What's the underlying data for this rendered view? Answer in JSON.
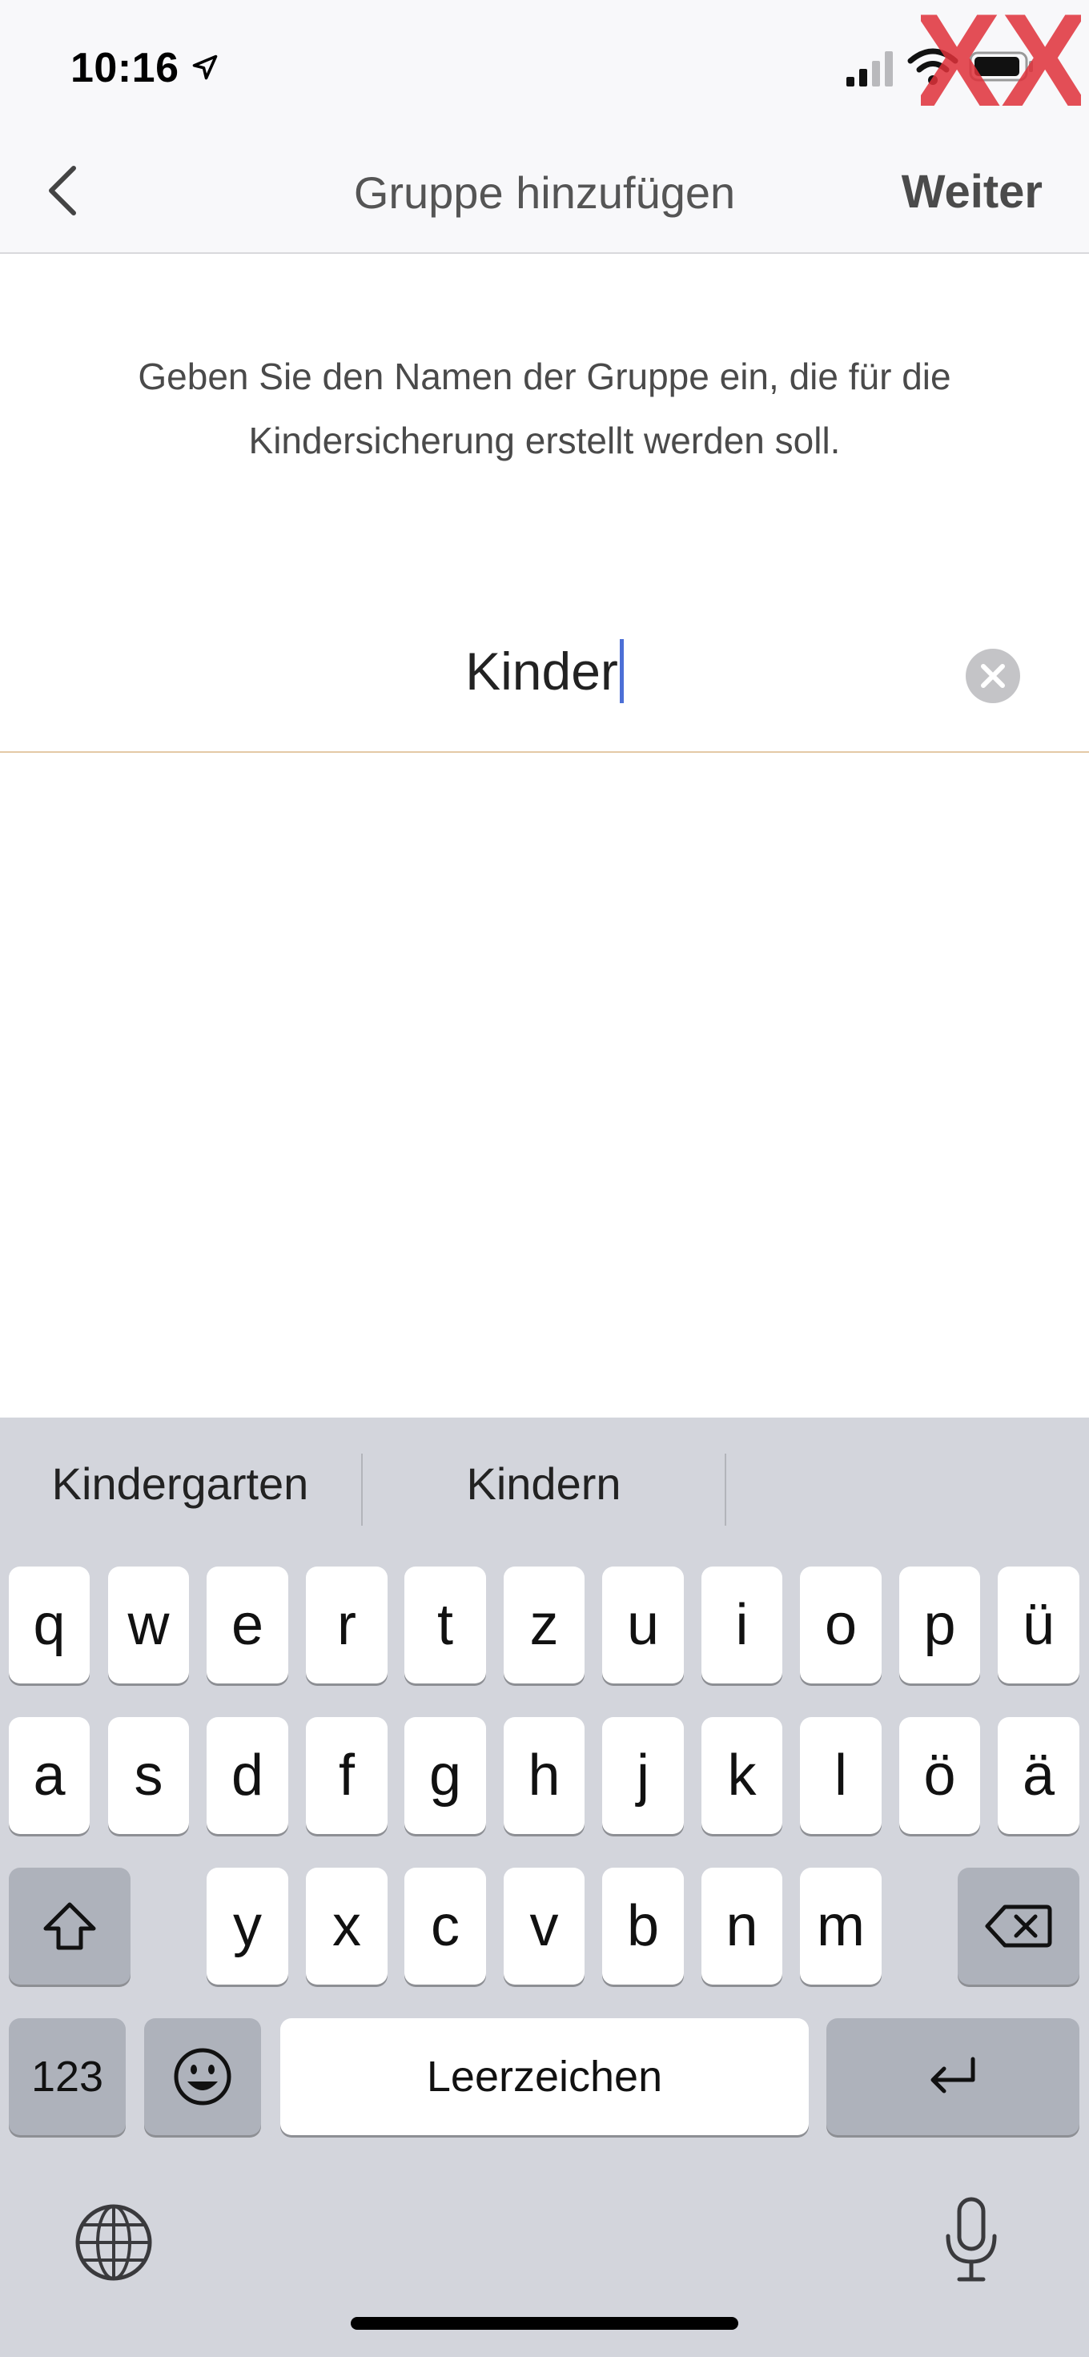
{
  "status_bar": {
    "time": "10:16"
  },
  "watermark": {
    "text": "XX"
  },
  "nav": {
    "back_icon": "chevron-left-icon",
    "title": "Gruppe hinzufügen",
    "next_label": "Weiter"
  },
  "description": "Geben Sie den Namen der Gruppe ein, die für die Kindersicherung erstellt werden soll.",
  "name_field": {
    "value": "Kinder"
  },
  "suggestions": [
    "Kindergarten",
    "Kindern",
    ""
  ],
  "keyboard": {
    "row1": [
      "q",
      "w",
      "e",
      "r",
      "t",
      "z",
      "u",
      "i",
      "o",
      "p",
      "ü"
    ],
    "row2": [
      "a",
      "s",
      "d",
      "f",
      "g",
      "h",
      "j",
      "k",
      "l",
      "ö",
      "ä"
    ],
    "row3": [
      "y",
      "x",
      "c",
      "v",
      "b",
      "n",
      "m"
    ],
    "numbers_label": "123",
    "space_label": "Leerzeichen"
  },
  "colors": {
    "caret": "#4c6fd6",
    "field_underline": "#e4c9a6",
    "watermark": "#e0313a",
    "keyboard_bg": "#d3d5dc"
  }
}
